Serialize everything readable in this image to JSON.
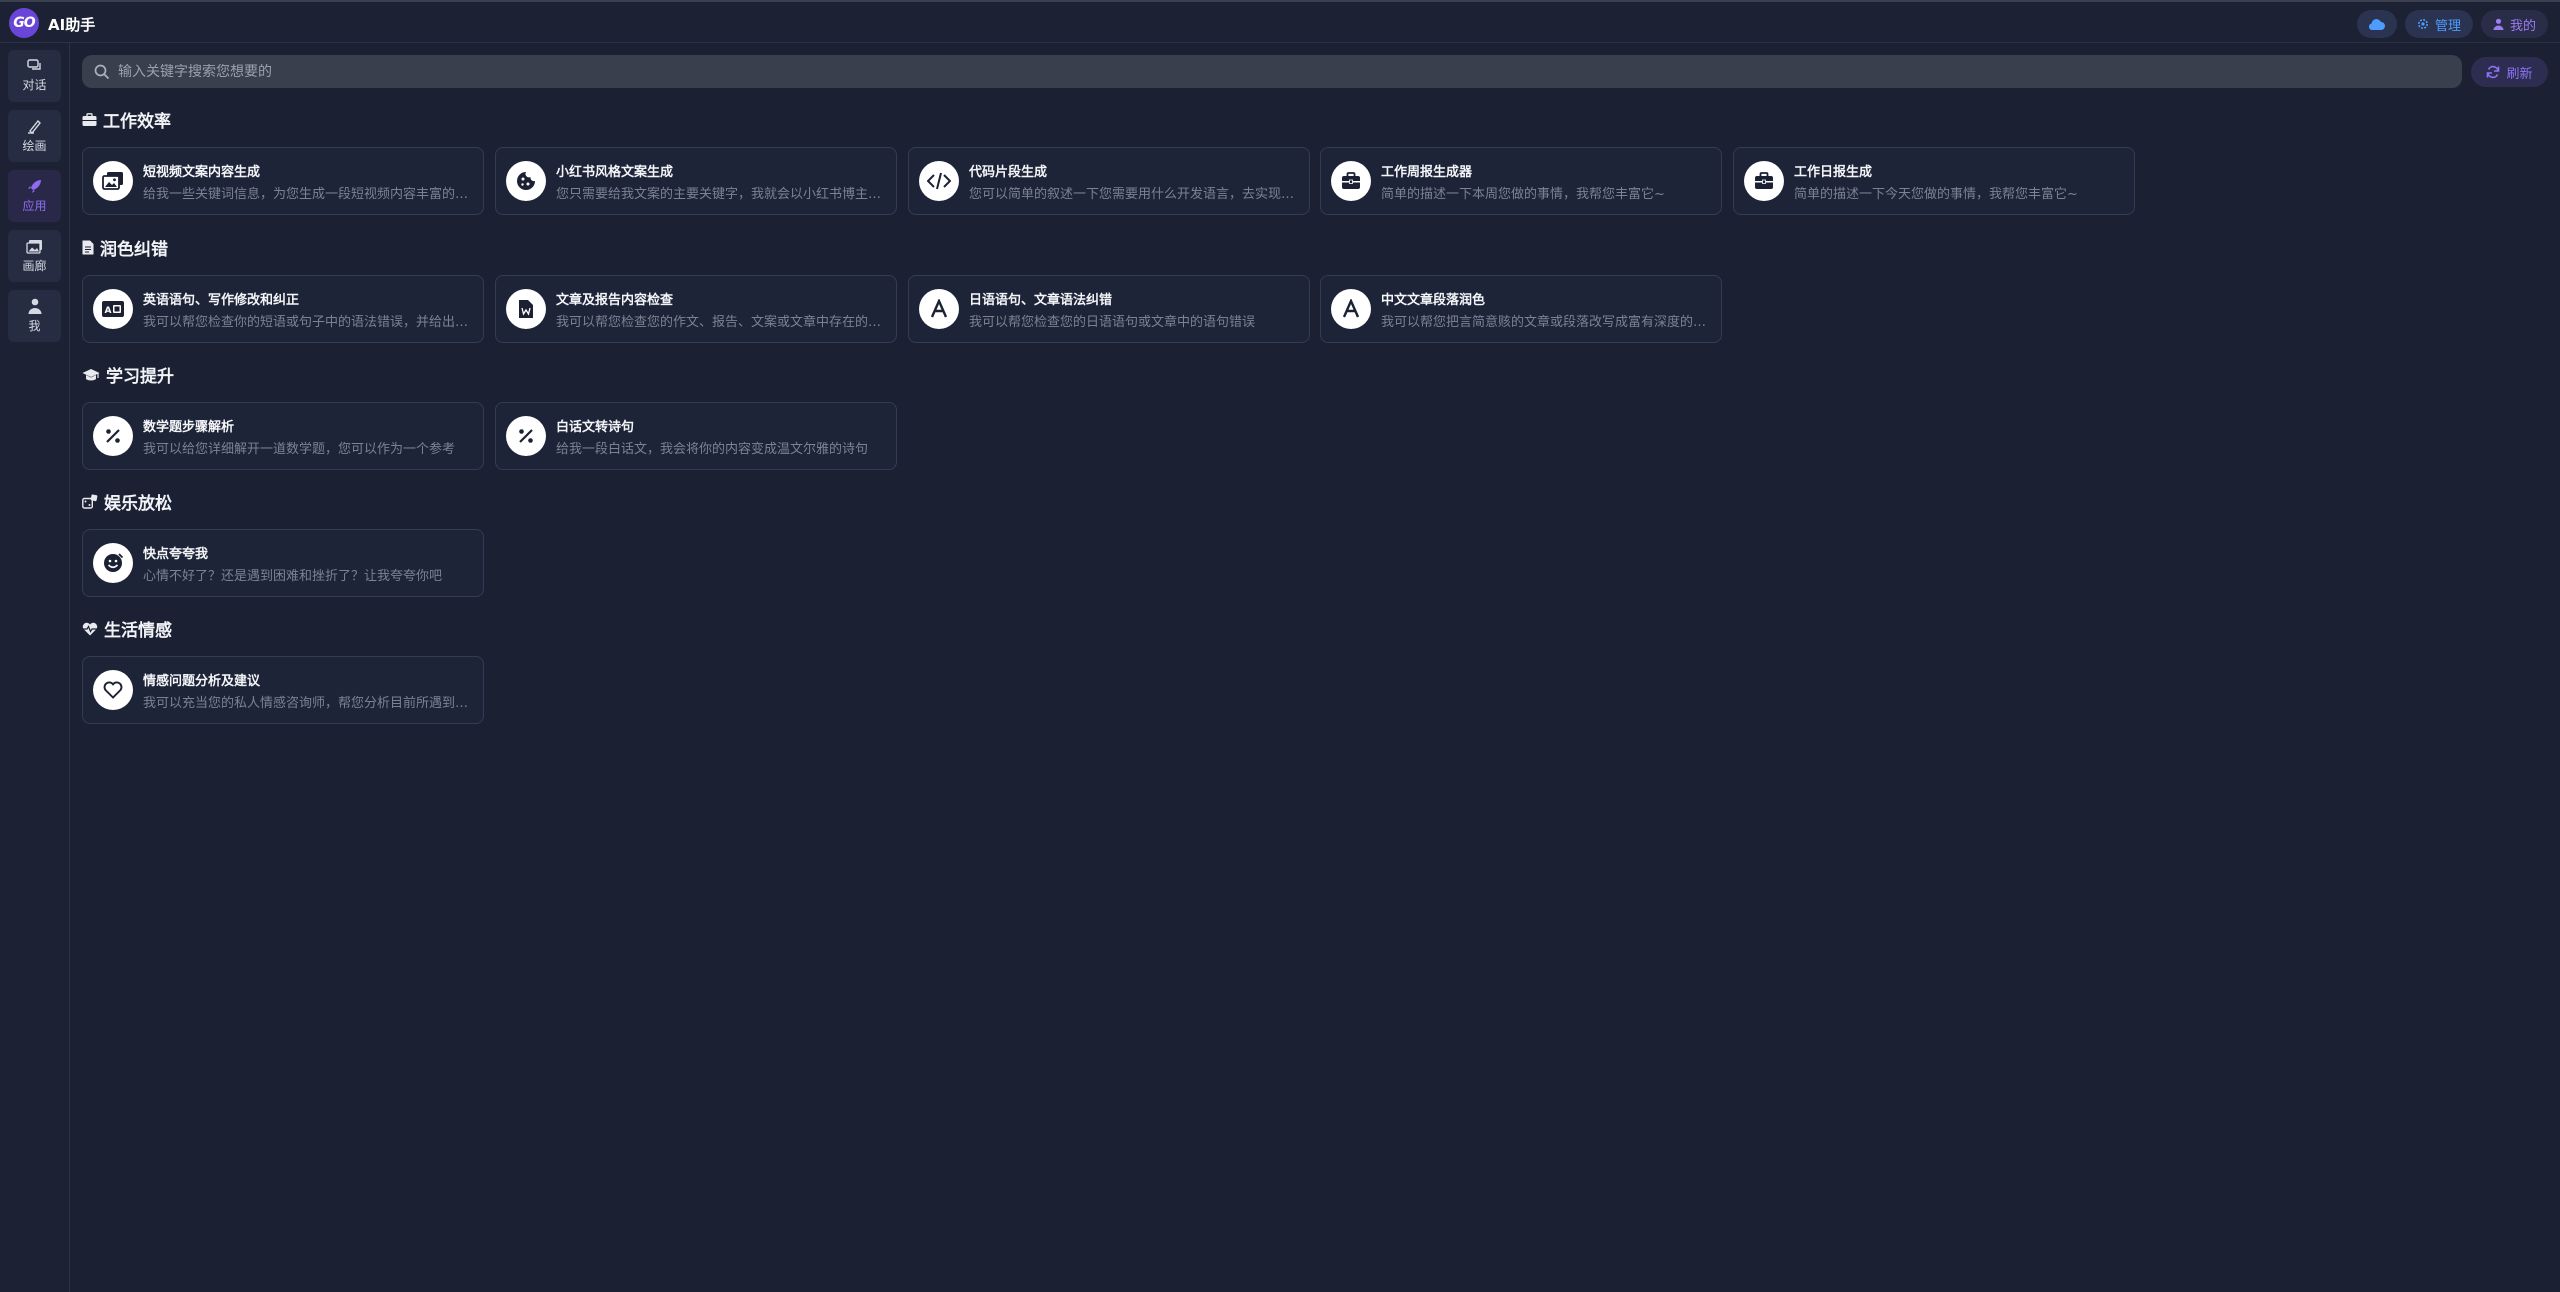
{
  "app": {
    "logo_text": "GO",
    "title": "AI助手"
  },
  "topbar": {
    "admin_label": "管理",
    "mine_label": "我的"
  },
  "sidebar": {
    "items": [
      {
        "label": "对话",
        "icon": "chat-icon"
      },
      {
        "label": "绘画",
        "icon": "brush-icon"
      },
      {
        "label": "应用",
        "icon": "rocket-icon"
      },
      {
        "label": "画廊",
        "icon": "gallery-icon"
      },
      {
        "label": "我",
        "icon": "user-icon"
      }
    ],
    "active_index": 2
  },
  "search": {
    "placeholder": "输入关键字搜索您想要的"
  },
  "refresh_label": "刷新",
  "sections": [
    {
      "title": "工作效率",
      "icon": "briefcase-icon",
      "cards": [
        {
          "title": "短视频文案内容生成",
          "desc": "给我一些关键词信息，为您生成一段短视频内容丰富的文案",
          "icon": "video-image-icon"
        },
        {
          "title": "小红书风格文案生成",
          "desc": "您只需要给我文案的主要关键字，我就会以小红书博主的风格为您生成文案",
          "icon": "cookie-icon"
        },
        {
          "title": "代码片段生成",
          "desc": "您可以简单的叙述一下您需要用什么开发语言，去实现什么功能",
          "icon": "code-icon"
        },
        {
          "title": "工作周报生成器",
          "desc": "简单的描述一下本周您做的事情，我帮您丰富它~",
          "icon": "briefcase-icon"
        },
        {
          "title": "工作日报生成",
          "desc": "简单的描述一下今天您做的事情，我帮您丰富它~",
          "icon": "briefcase-icon"
        }
      ]
    },
    {
      "title": "润色纠错",
      "icon": "document-icon",
      "cards": [
        {
          "title": "英语语句、写作修改和纠正",
          "desc": "我可以帮您检查你的短语或句子中的语法错误，并给出修改建议",
          "icon": "id-card-icon"
        },
        {
          "title": "文章及报告内容检查",
          "desc": "我可以帮您检查您的作文、报告、文案或文章中存在的问题",
          "icon": "word-file-icon"
        },
        {
          "title": "日语语句、文章语法纠错",
          "desc": "我可以帮您检查您的日语语句或文章中的语句错误",
          "icon": "font-icon"
        },
        {
          "title": "中文文章段落润色",
          "desc": "我可以帮您把言简意赅的文章或段落改写成富有深度的内容",
          "icon": "font-icon"
        }
      ]
    },
    {
      "title": "学习提升",
      "icon": "graduation-cap-icon",
      "cards": [
        {
          "title": "数学题步骤解析",
          "desc": "我可以给您详细解开一道数学题，您可以作为一个参考",
          "icon": "percent-icon"
        },
        {
          "title": "白话文转诗句",
          "desc": "给我一段白话文，我会将你的内容变成温文尔雅的诗句",
          "icon": "percent-icon"
        }
      ]
    },
    {
      "title": "娱乐放松",
      "icon": "dice-icon",
      "cards": [
        {
          "title": "快点夸夸我",
          "desc": "心情不好了？还是遇到困难和挫折了？让我夸夸你吧",
          "icon": "smile-icon"
        }
      ]
    },
    {
      "title": "生活情感",
      "icon": "heart-pulse-icon",
      "cards": [
        {
          "title": "情感问题分析及建议",
          "desc": "我可以充当您的私人情感咨询师，帮您分析目前所遇到的情感问题",
          "icon": "heart-icon"
        }
      ]
    }
  ]
}
